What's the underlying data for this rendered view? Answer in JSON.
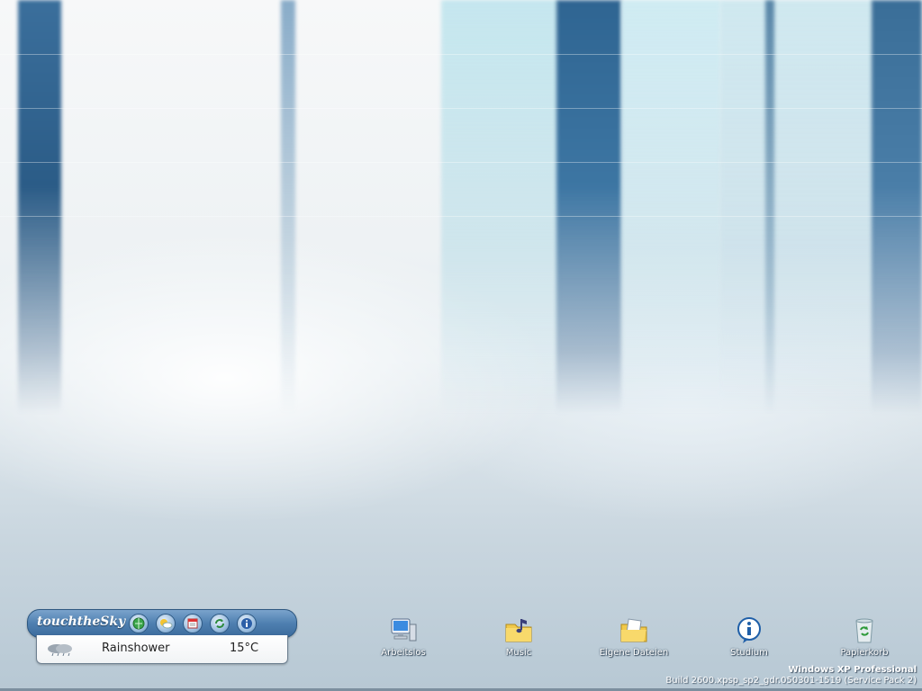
{
  "widget": {
    "title": "touchtheSky",
    "buttons": [
      {
        "icon": "globe-icon"
      },
      {
        "icon": "sun-cloud-icon"
      },
      {
        "icon": "calendar-icon"
      },
      {
        "icon": "refresh-icon"
      },
      {
        "icon": "info-icon"
      }
    ],
    "weather_icon": "rain-cloud-icon",
    "condition": "Rainshower",
    "temperature": "15°C"
  },
  "desktop_icons": [
    {
      "label": "Arbeitslos",
      "icon": "computer-icon"
    },
    {
      "label": "Music",
      "icon": "music-folder-icon"
    },
    {
      "label": "Eigene Dateien",
      "icon": "documents-folder-icon"
    },
    {
      "label": "Studium",
      "icon": "info-bubble-icon"
    },
    {
      "label": "Papierkorb",
      "icon": "recycle-bin-icon"
    }
  ],
  "os_info": {
    "edition": "Windows XP Professional",
    "build": "Build 2600.xpsp_sp2_gdr.050301-1519 (Service Pack 2)"
  },
  "colors": {
    "widget_bar": "#4e7fb0",
    "wallpaper_stripe": "#2f6592",
    "label_text": "#ffffff"
  }
}
